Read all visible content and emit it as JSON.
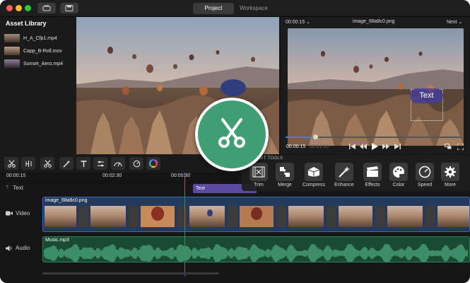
{
  "window": {
    "tabs": [
      {
        "label": "Project",
        "active": true
      },
      {
        "label": "Workspace",
        "active": false
      }
    ]
  },
  "asset_library": {
    "title": "Asset Library",
    "items": [
      {
        "label": "H_A_Cfp1.mp4"
      },
      {
        "label": "Capp_B-Roll.mov"
      },
      {
        "label": "Sunset_Aero.mp4"
      }
    ]
  },
  "player": {
    "timecode": "00:00:15",
    "file_name": "image_68a8c0.png",
    "next_label": "Next",
    "overlay_text": "Text",
    "current_time": "00:00:15",
    "total_time": "00:01:30",
    "progress": 0.17
  },
  "ruler": {
    "labels": [
      "00:00:15",
      "00:02:30",
      "00:00:30"
    ]
  },
  "timeline": {
    "tracks": [
      {
        "label": "Text"
      },
      {
        "label": "Video"
      },
      {
        "label": "Audio"
      }
    ],
    "text_clip": "Text",
    "video_clip": "image_68a8c0.png",
    "audio_clip": "Music.mp3"
  },
  "edit_tools": {
    "title": "EDIT TOOLS",
    "tools": [
      {
        "label": "Trim"
      },
      {
        "label": "Merge"
      },
      {
        "label": "Compress"
      },
      {
        "label": "Enhance"
      },
      {
        "label": "Effects"
      },
      {
        "label": "Color"
      },
      {
        "label": "Speed"
      },
      {
        "label": "More"
      }
    ]
  },
  "colors": {
    "accent_blue": "#3c7cf5",
    "cut_green": "#3f9f73",
    "text_clip": "#5b4a9f",
    "video_clip": "#233a5c",
    "audio_clip": "#1b4a32"
  }
}
